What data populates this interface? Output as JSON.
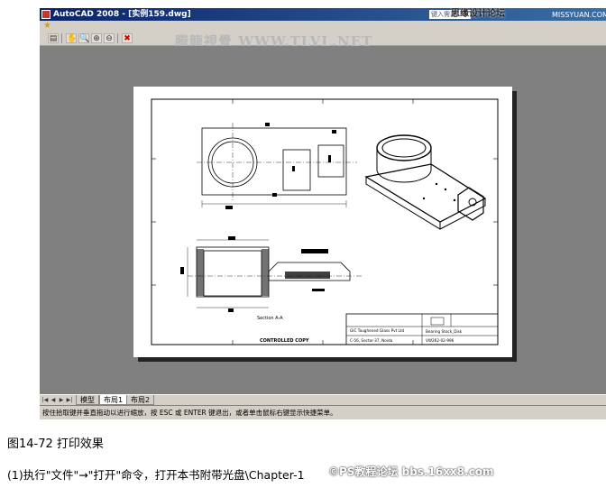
{
  "window": {
    "title": "AutoCAD 2008 - [实例159.dwg]",
    "help_placeholder": "键入需要",
    "watermark_right": "思缘设计论坛",
    "watermark_url": "MISSYUAN.COM"
  },
  "toolbar": {
    "watermark": "腾龍視覺 WWW.TLVL.NET",
    "buttons": [
      {
        "icon": "print-preview-icon",
        "glyph": "▤"
      },
      {
        "icon": "pan-icon",
        "glyph": "✋"
      },
      {
        "icon": "zoom-realtime-icon",
        "glyph": "🔍"
      },
      {
        "icon": "zoom-window-icon",
        "glyph": "⊕"
      },
      {
        "icon": "zoom-original-icon",
        "glyph": "⊖"
      },
      {
        "icon": "close-preview-icon",
        "glyph": "✖"
      }
    ]
  },
  "drawing": {
    "title_block": {
      "company": "GIC Toughened Glass Pvt Ltd",
      "address": "C-56, Sector-37, Noida",
      "title": "Bearing Stock_Disk",
      "drawing_no": "VW262-02-996"
    },
    "section_label": "Section A-A",
    "controlled_copy": "CONTROLLED COPY"
  },
  "tabs": {
    "items": [
      {
        "label": "模型",
        "active": false
      },
      {
        "label": "布局1",
        "active": true
      },
      {
        "label": "布局2",
        "active": false
      }
    ]
  },
  "status": {
    "text": "按住拾取键并垂直拖动以进行缩放，按 ESC 或 ENTER 键退出，或者单击鼠标右键显示快捷菜单。"
  },
  "article": {
    "caption": "图14-72  打印效果",
    "paragraph": "(1)执行\"文件\"→\"打开\"命令，打开本书附带光盘\\Chapter-1",
    "watermark": "©PS教程论坛 bbs.16xx8.com"
  },
  "colors": {
    "canvas": "#808080",
    "ui_face": "#d4d0c8",
    "title_bar": "#0a246a"
  }
}
